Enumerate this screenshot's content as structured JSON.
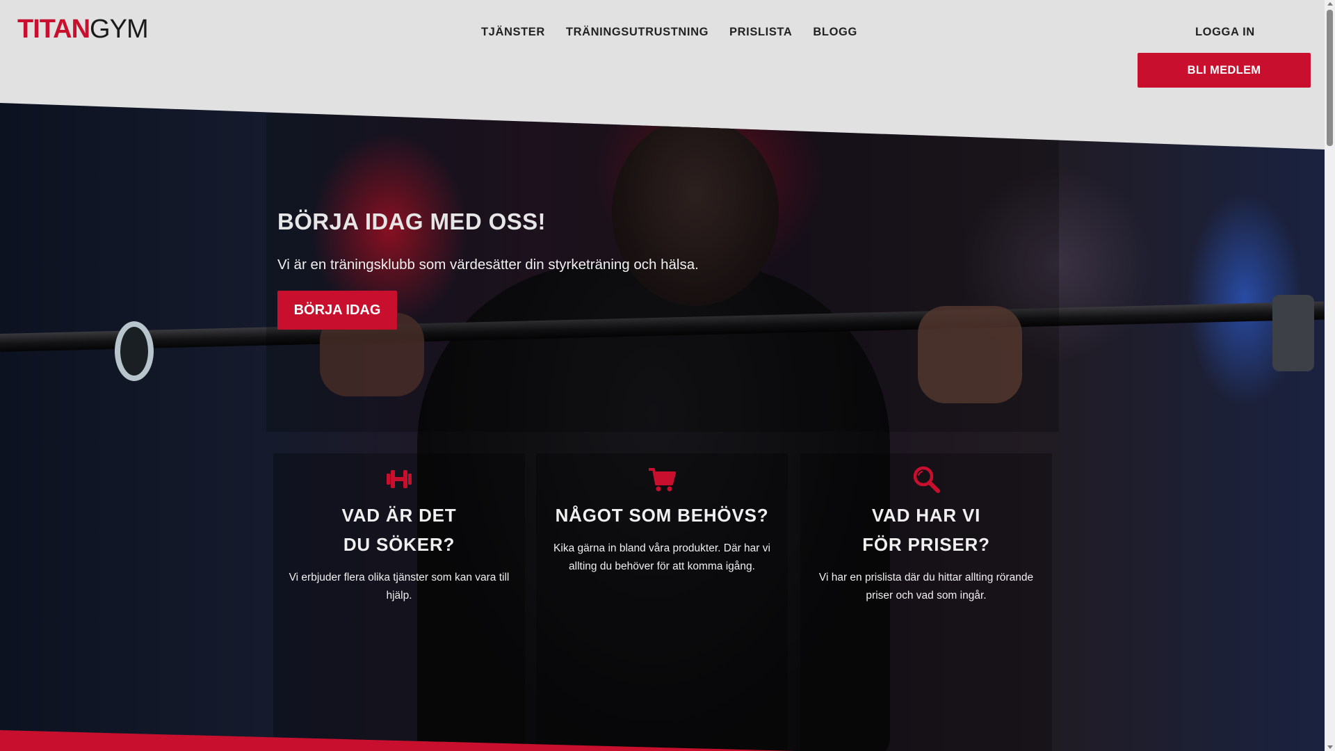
{
  "brand": {
    "logo_bold": "TITAN",
    "logo_light": "GYM",
    "accent": "#c8102e"
  },
  "nav": {
    "items": [
      {
        "label": "TJÄNSTER"
      },
      {
        "label": "TRÄNINGSUTRUSTNING"
      },
      {
        "label": "PRISLISTA"
      },
      {
        "label": "BLOGG"
      }
    ]
  },
  "header": {
    "login": "LOGGA IN",
    "join": "BLI MEDLEM"
  },
  "hero": {
    "title": "BÖRJA IDAG MED OSS!",
    "subtitle": "Vi är en träningsklubb som värdesätter din styrketräning och hälsa.",
    "cta": "BÖRJA IDAG"
  },
  "cards": [
    {
      "icon": "dumbbell-icon",
      "title_line1": "VAD ÄR DET",
      "title_line2": "DU SÖKER?",
      "text": "Vi erbjuder flera olika tjänster som kan vara till hjälp."
    },
    {
      "icon": "shopping-cart-icon",
      "title_line1": "NÅGOT SOM BEHÖVS?",
      "text": "Kika gärna in bland våra produkter. Där har vi allting du behöver för att komma igång."
    },
    {
      "icon": "search-icon",
      "title_line1": "VAD HAR VI",
      "title_line2": "FÖR PRISER?",
      "text": "Vi har en prislista där du hittar allting rörande priser och vad som ingår."
    }
  ]
}
